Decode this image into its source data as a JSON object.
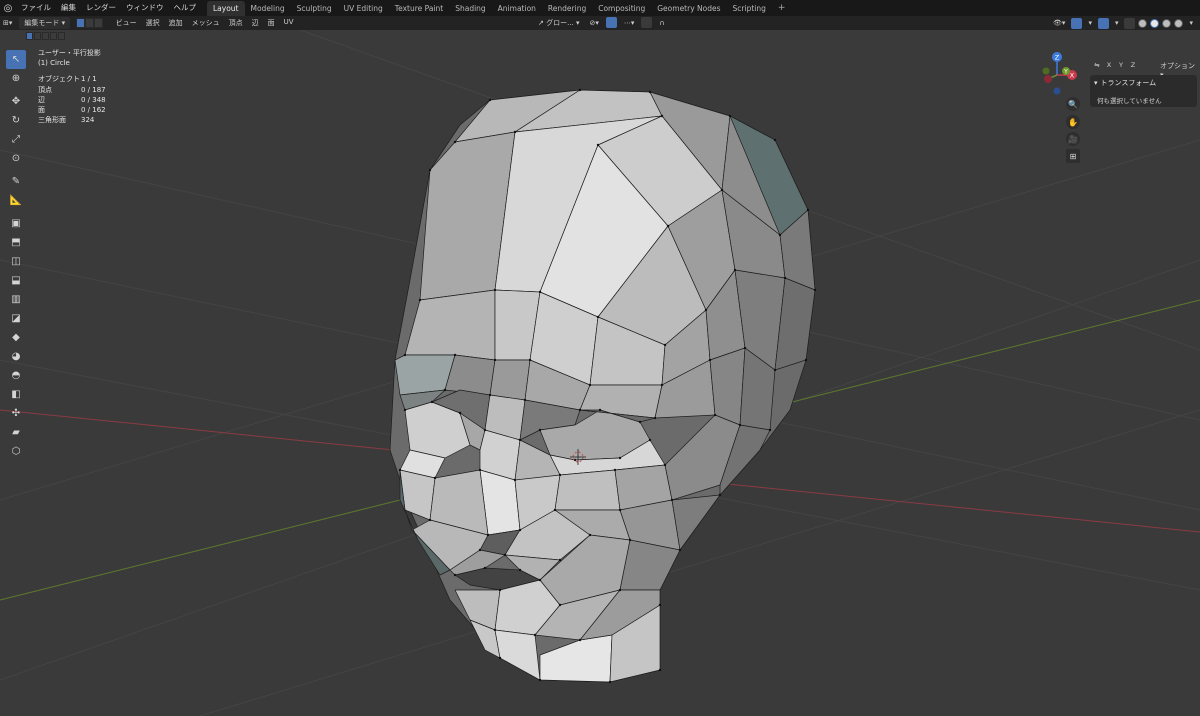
{
  "menubar": {
    "items": [
      "ファイル",
      "編集",
      "レンダー",
      "ウィンドウ",
      "ヘルプ"
    ]
  },
  "workspace_tabs": [
    "Layout",
    "Modeling",
    "Sculpting",
    "UV Editing",
    "Texture Paint",
    "Shading",
    "Animation",
    "Rendering",
    "Compositing",
    "Geometry Nodes",
    "Scripting"
  ],
  "active_tab": "Layout",
  "header": {
    "mode": "編集モード",
    "menus": [
      "ビュー",
      "選択",
      "追加",
      "メッシュ",
      "頂点",
      "辺",
      "面",
      "UV"
    ],
    "orientation": "グロー...",
    "xyz": [
      "X",
      "Y",
      "Z"
    ],
    "options": "オプション"
  },
  "overlay": {
    "view_name": "ユーザー・平行投影",
    "object_name": "(1) Circle",
    "stats": [
      {
        "label": "オブジェクト",
        "value": "1 / 1"
      },
      {
        "label": "頂点",
        "value": "0 / 187"
      },
      {
        "label": "辺",
        "value": "0 / 348"
      },
      {
        "label": "面",
        "value": "0 / 162"
      },
      {
        "label": "三角形面",
        "value": "324"
      }
    ]
  },
  "npanel": {
    "title": "トランスフォーム",
    "body": "何も選択していません"
  },
  "gizmo": {
    "x": "X",
    "y": "Y",
    "z": "Z"
  },
  "colors": {
    "viewport_bg": "#3a3a3a",
    "accent": "#4772b3",
    "axis_x": "#c8394c",
    "axis_y": "#6e9a2a",
    "axis_z": "#3d7be0"
  }
}
